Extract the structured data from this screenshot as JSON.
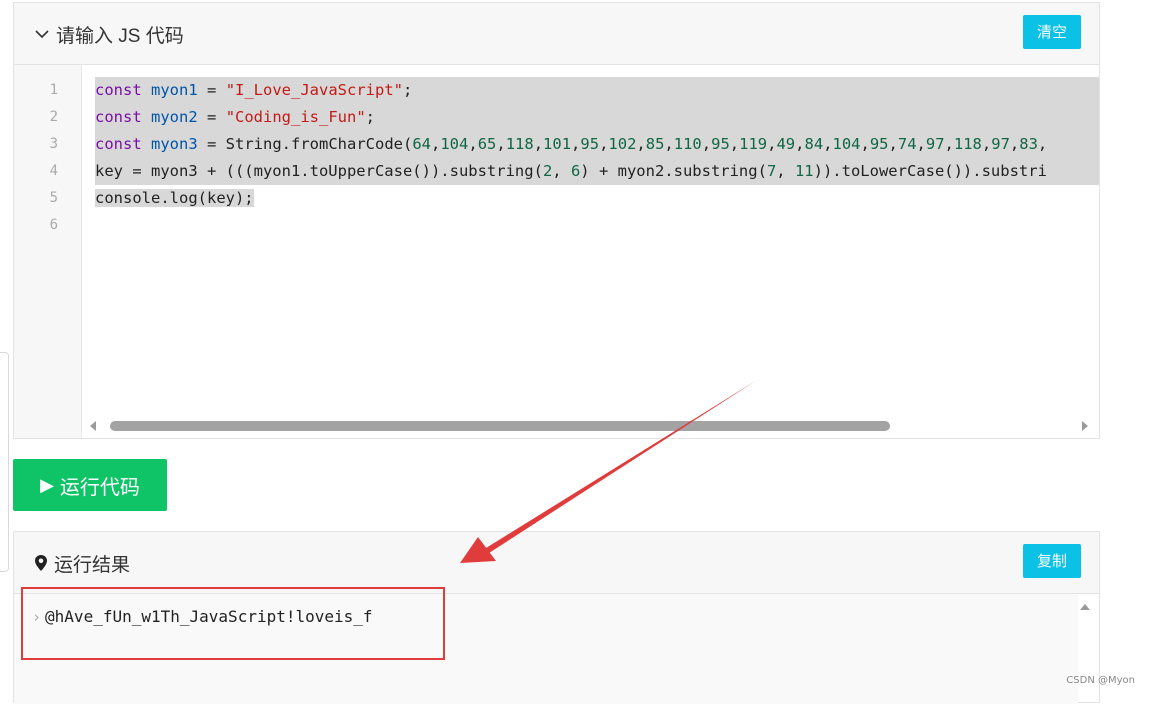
{
  "editor": {
    "title": "请输入 JS 代码",
    "clear_label": "清空",
    "line_numbers": [
      "1",
      "2",
      "3",
      "4",
      "5",
      "6"
    ],
    "lines": [
      {
        "t1": "const",
        "t2": " ",
        "t3": "myon1",
        "t4": " = ",
        "t5": "\"I_Love_JavaScript\"",
        "t6": ";"
      },
      {
        "t1": "const",
        "t2": " ",
        "t3": "myon2",
        "t4": " = ",
        "t5": "\"Coding_is_Fun\"",
        "t6": ";"
      },
      {
        "t1": "const",
        "t2": " ",
        "t3": "myon3",
        "t4": " = String.fromCharCode(",
        "nums": [
          "64",
          "104",
          "65",
          "118",
          "101",
          "95",
          "102",
          "85",
          "110",
          "95",
          "119",
          "49",
          "84",
          "104",
          "95",
          "74",
          "97",
          "118",
          "97",
          "83"
        ]
      },
      {
        "a": "key = myon3 + (((myon1.toUpperCase()).substring(",
        "n1": "2",
        "b": ", ",
        "n2": "6",
        "c": ") + myon2.substring(",
        "n3": "7",
        "d": ", ",
        "n4": "11",
        "e": ")).toLowerCase()).substri"
      },
      {
        "text": "console.log(key);"
      },
      {
        "text": ""
      }
    ]
  },
  "run_button_label": "运行代码",
  "result": {
    "title": "运行结果",
    "copy_label": "复制",
    "output": "@hAve_fUn_w1Th_JavaScript!loveis_f"
  },
  "watermark": "CSDN @Myon⁠",
  "colors": {
    "accent_cyan": "#0bc1e6",
    "run_green": "#0fc466",
    "highlight_red": "#e03c3c"
  }
}
